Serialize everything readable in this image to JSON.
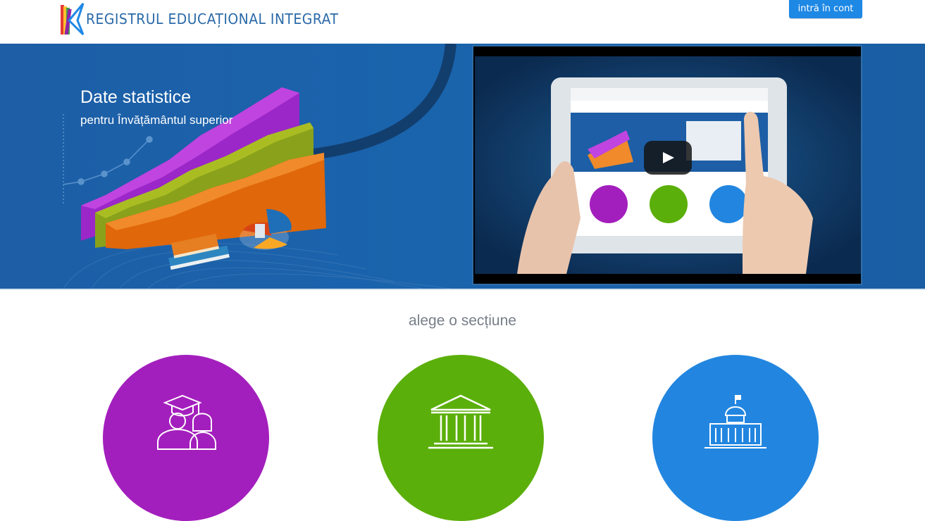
{
  "header": {
    "logo_text": "REGISTRUL EDUCAȚIONAL INTEGRAT",
    "login_label": "intră în cont"
  },
  "hero": {
    "title": "Date statistice",
    "subtitle": "pentru Învățământul superior"
  },
  "video": {
    "play_icon": "play-icon"
  },
  "sections": {
    "title": "alege o secțiune",
    "items": [
      {
        "icon": "students-icon",
        "color": "#a31fbd"
      },
      {
        "icon": "institution-icon",
        "color": "#5baf0a"
      },
      {
        "icon": "ministry-building-icon",
        "color": "#2286e0"
      }
    ]
  },
  "colors": {
    "brand_blue": "#2a6aa8",
    "button_blue": "#1e88e5",
    "hero_blue": "#1a64ad"
  }
}
